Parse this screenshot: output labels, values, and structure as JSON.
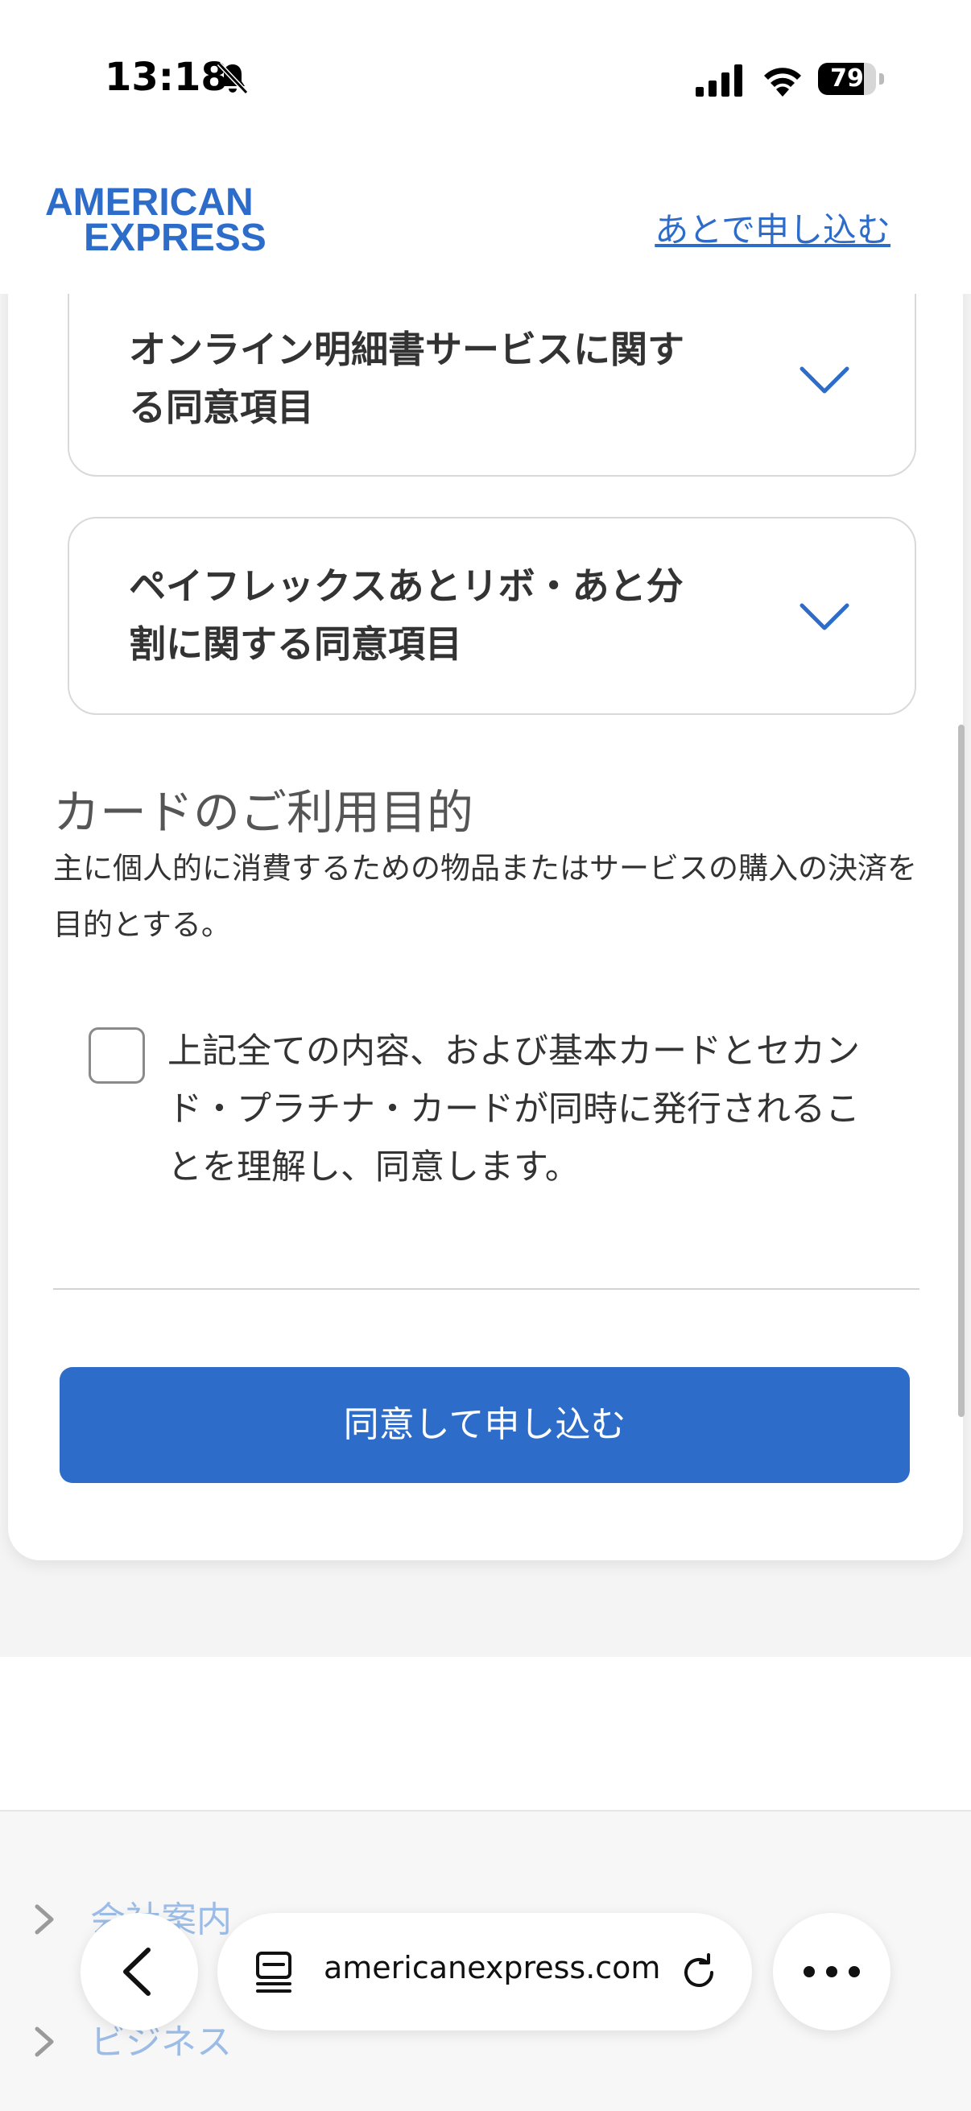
{
  "status_bar": {
    "time": "13:18",
    "battery": "79",
    "battery_level": 0.79,
    "icons": [
      "bell-slash-icon",
      "signal-icon",
      "wifi-icon",
      "battery-icon"
    ]
  },
  "header": {
    "logo_line1": "AMERICAN",
    "logo_line2": "EXPRESS",
    "later_link": "あとで申し込む",
    "brand_color": "#2d6cc9"
  },
  "accordions": [
    {
      "title": "オンライン明細書サービスに関する同意項目"
    },
    {
      "title": "ペイフレックスあとリボ・あと分割に関する同意項目"
    }
  ],
  "purpose": {
    "heading": "カードのご利用目的",
    "text": "主に個人的に消費するための物品またはサービスの購入の決済を目的とする。"
  },
  "agreement": {
    "checked": false,
    "text": "上記全ての内容、および基本カードとセカンド・プラチナ・カードが同時に発行されることを理解し、同意します。"
  },
  "submit_button": "同意して申し込む",
  "footer": {
    "items": [
      "会社案内",
      "ビジネス"
    ]
  },
  "browser": {
    "url": "americanexpress.com"
  }
}
